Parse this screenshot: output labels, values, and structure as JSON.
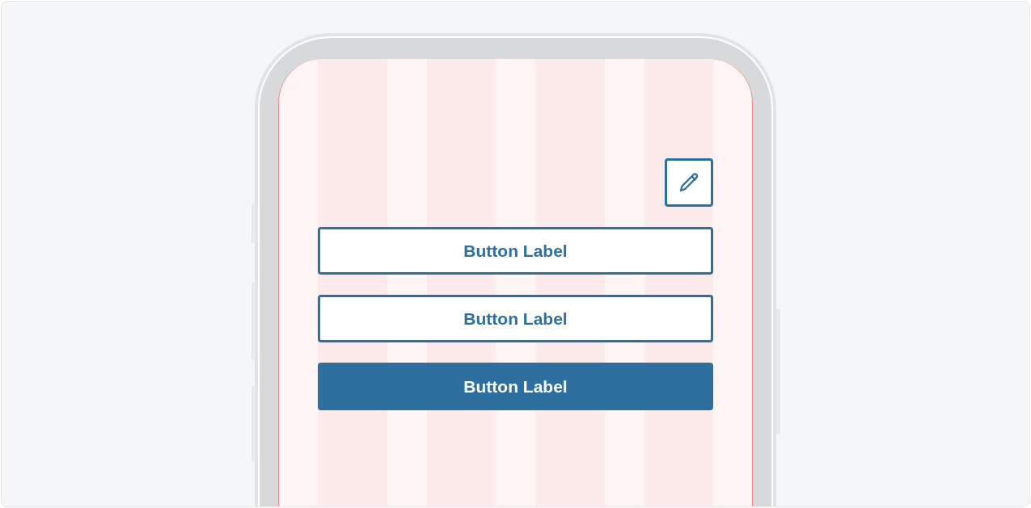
{
  "buttons": [
    {
      "label": "Button Label",
      "kind": "outline"
    },
    {
      "label": "Button Label",
      "kind": "outline"
    },
    {
      "label": "Button Label",
      "kind": "filled"
    }
  ]
}
